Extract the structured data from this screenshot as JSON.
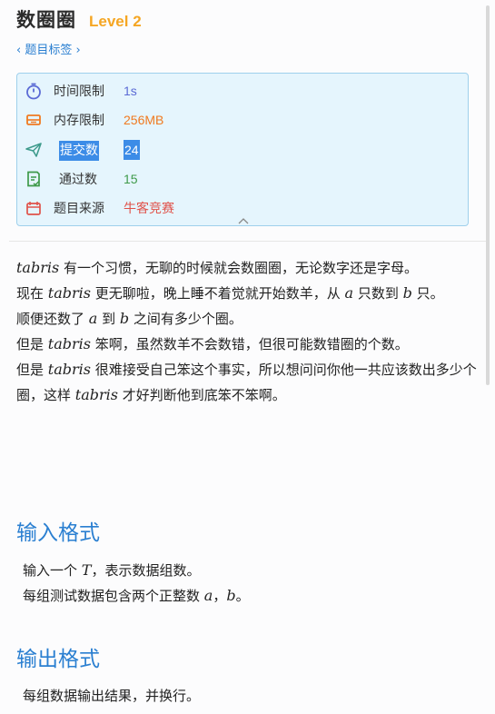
{
  "problem": {
    "title": "数圈圈",
    "level": "Level 2",
    "tags_link": "‹ 题目标签 ›"
  },
  "info": {
    "time_limit": {
      "label": "时间限制",
      "value": "1s",
      "color": "#5b6bd5"
    },
    "memory_limit": {
      "label": "内存限制",
      "value": "256MB",
      "color": "#f07a20"
    },
    "submissions": {
      "label": "提交数",
      "value": "24"
    },
    "accepted": {
      "label": "通过数",
      "value": "15",
      "color": "#3f9a4a"
    },
    "source": {
      "label": "题目来源",
      "value": "牛客竞赛",
      "color": "#e0524a"
    }
  },
  "description": {
    "p1a": "tabris",
    "p1b": " 有一个习惯，无聊的时候就会数圈圈，无论数字还是字母。",
    "p2a": "现在 ",
    "p2b": "tabris",
    "p2c": " 更无聊啦，晚上睡不着觉就开始数羊，从 ",
    "p2d": "a",
    "p2e": " 只数到 ",
    "p2f": "b",
    "p2g": " 只。",
    "p3a": "顺便还数了 ",
    "p3b": "a",
    "p3c": " 到 ",
    "p3d": "b",
    "p3e": " 之间有多少个圈。",
    "p4a": "但是 ",
    "p4b": "tabris",
    "p4c": " 笨啊，虽然数羊不会数错，但很可能数错圈的个数。",
    "p5a": "但是 ",
    "p5b": "tabris",
    "p5c": " 很难接受自己笨这个事实，所以想问问你他一共应该数出多少个圈，这样 ",
    "p5d": "tabris",
    "p5e": " 才好判断他到底笨不笨啊。"
  },
  "input_section": {
    "heading": "输入格式",
    "l1a": "输入一个 ",
    "l1b": "T",
    "l1c": "，表示数据组数。",
    "l2a": "每组测试数据包含两个正整数 ",
    "l2b": "a",
    "l2c": "，",
    "l2d": "b",
    "l2e": "。"
  },
  "output_section": {
    "heading": "输出格式",
    "l1": "每组数据输出结果，并换行。"
  },
  "icons": {
    "time": "stopwatch-icon",
    "memory": "memory-chip-icon",
    "submit": "paper-plane-icon",
    "accepted": "checklist-icon",
    "source": "box-icon",
    "collapse": "chevron-up-icon"
  }
}
